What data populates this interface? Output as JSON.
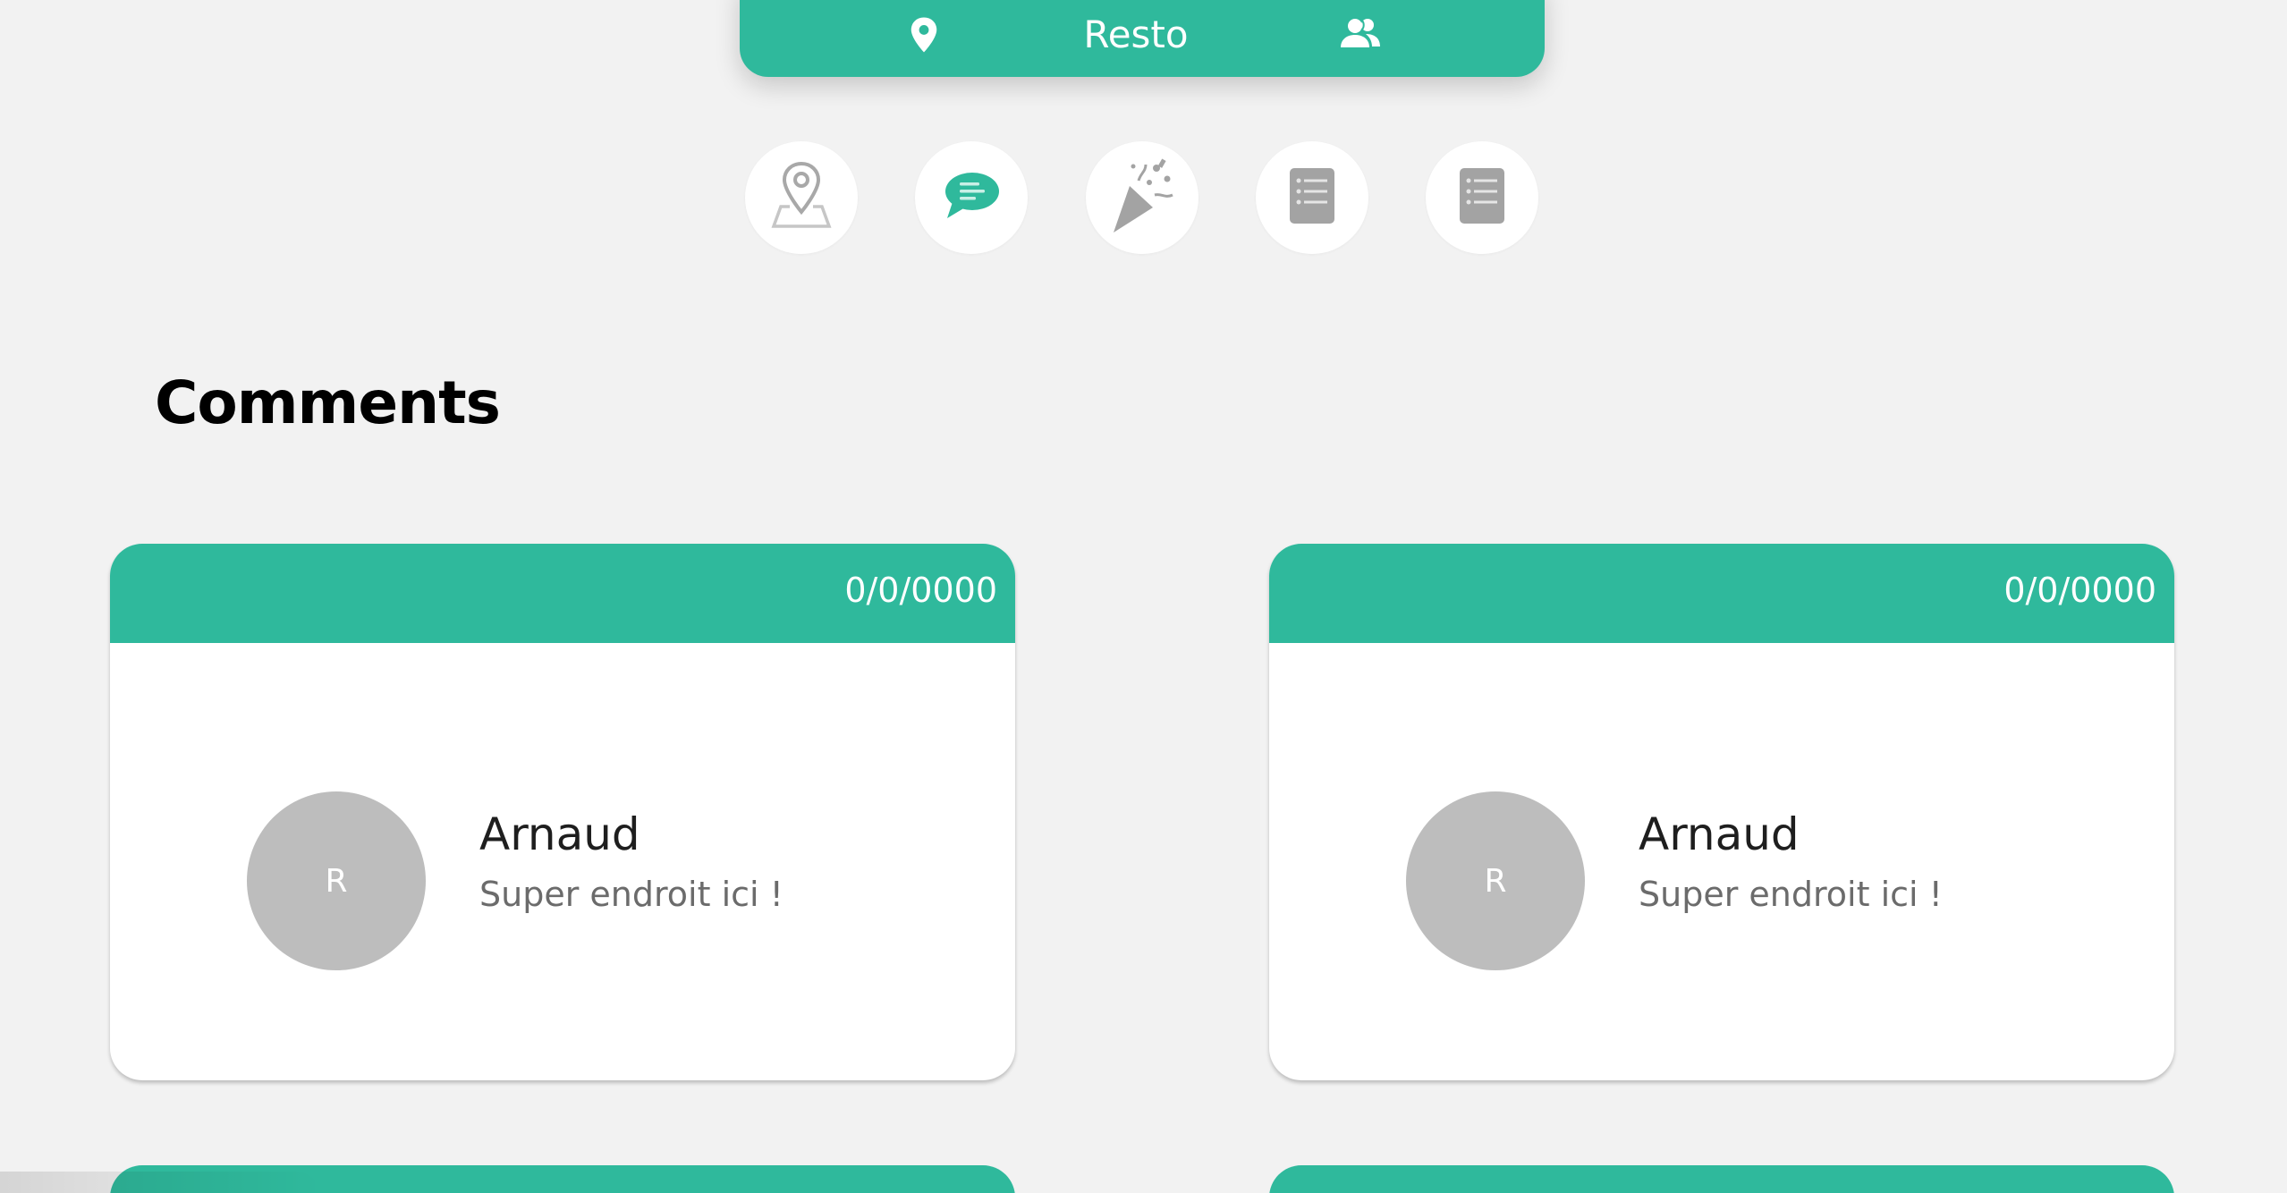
{
  "header": {
    "title": "Resto",
    "left_icon": "location-pin-icon",
    "right_icon": "people-icon"
  },
  "nav": [
    {
      "icon": "map-pin-icon",
      "active": false
    },
    {
      "icon": "comment-icon",
      "active": true
    },
    {
      "icon": "party-popper-icon",
      "active": false
    },
    {
      "icon": "list-document-icon",
      "active": false
    },
    {
      "icon": "list-document-icon",
      "active": false
    }
  ],
  "section_title": "Comments",
  "comments": [
    {
      "date": "0/0/0000",
      "avatar_letter": "R",
      "author": "Arnaud",
      "text": "Super endroit ici !"
    },
    {
      "date": "0/0/0000",
      "avatar_letter": "R",
      "author": "Arnaud",
      "text": "Super endroit ici !"
    }
  ],
  "colors": {
    "accent": "#2fb99c",
    "background": "#f2f2f2",
    "avatar": "#bdbdbd",
    "icon_inactive": "#9e9e9e"
  }
}
